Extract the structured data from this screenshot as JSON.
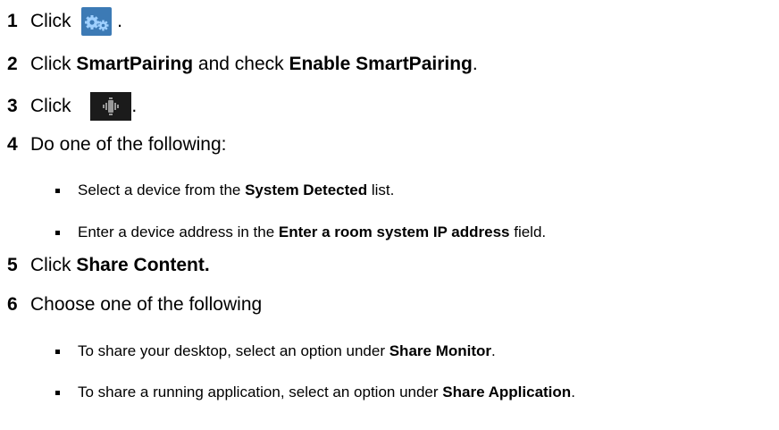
{
  "steps": [
    {
      "num": "1",
      "pre": "Click ",
      "post": " ."
    },
    {
      "num": "2",
      "t1": "Click ",
      "b1": "SmartPairing",
      "t2": " and check ",
      "b2": "Enable SmartPairing",
      "t3": "."
    },
    {
      "num": "3",
      "pre": "Click ",
      "post": "."
    },
    {
      "num": "4",
      "text": "Do one of the following:"
    },
    {
      "num": "5",
      "t1": "Click ",
      "b1": "Share Content."
    },
    {
      "num": "6",
      "text": "Choose one of the following"
    }
  ],
  "bullets": [
    {
      "t1": "Select a device from the ",
      "b1": "System Detected",
      "t2": " list."
    },
    {
      "t1": "Enter a device address in the ",
      "b1": "Enter a room system IP address",
      "t2": " field."
    },
    {
      "t1": "To share your desktop, select an option under ",
      "b1": "Share Monitor",
      "t2": "."
    },
    {
      "t1": "To share a running application, select an option under ",
      "b1": "Share Application",
      "t2": "."
    }
  ],
  "icons": {
    "settings": "gears-icon",
    "smartpairing": "smartpairing-icon"
  },
  "colors": {
    "gears_bg": "#3c7ab5",
    "pair_bg": "#1b1b1b"
  }
}
